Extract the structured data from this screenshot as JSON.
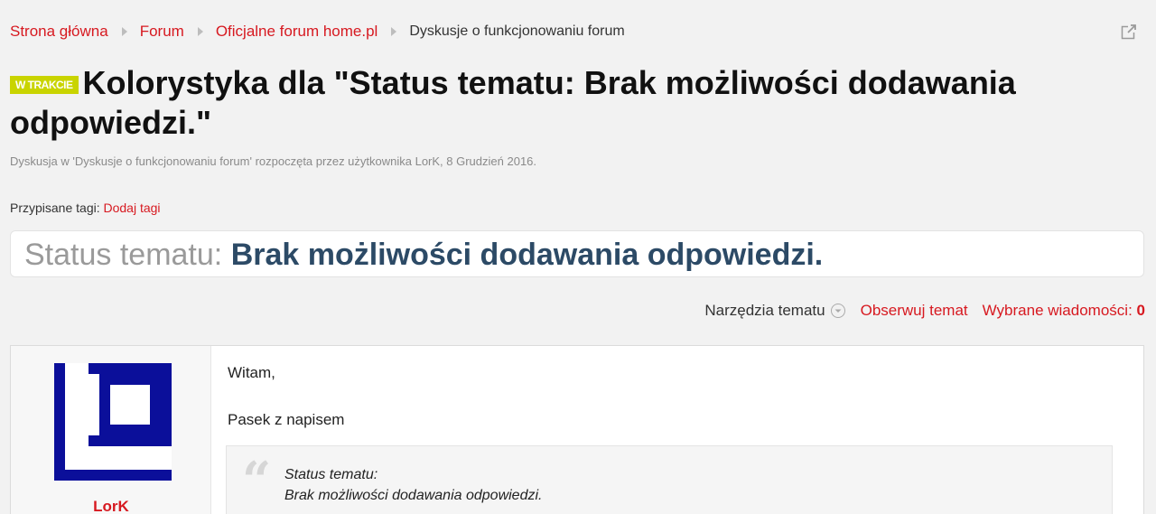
{
  "breadcrumb": {
    "items": [
      "Strona główna",
      "Forum",
      "Oficjalne forum home.pl"
    ],
    "current": "Dyskusje o funkcjonowaniu forum"
  },
  "thread": {
    "prefix": "W TRAKCIE",
    "title": "Kolorystyka dla \"Status tematu: Brak możliwości dodawania odpowiedzi.\"",
    "description": "Dyskusja w 'Dyskusje o funkcjonowaniu forum' rozpoczęta przez użytkownika LorK, 8 Grudzień 2016."
  },
  "tags": {
    "label": "Przypisane tagi:",
    "add_link": "Dodaj tagi"
  },
  "status": {
    "label": "Status tematu:",
    "value": "Brak możliwości dodawania odpowiedzi."
  },
  "tools": {
    "menu_label": "Narzędzia tematu",
    "watch_label": "Obserwuj temat",
    "selected_label": "Wybrane wiadomości:",
    "selected_count": "0"
  },
  "post": {
    "username": "LorK",
    "lines": [
      "Witam,",
      "Pasek z napisem"
    ],
    "quote": [
      "Status tematu:",
      "Brak możliwości dodawania odpowiedzi."
    ]
  },
  "colors": {
    "link": "#d71920",
    "prefix_badge": "#c9d400",
    "status_value": "#2c4a66",
    "avatar_blue": "#0b0f9a"
  },
  "icons": [
    "chevron-right-icon",
    "popout-icon",
    "circle-chevron-down-icon",
    "quote-icon"
  ]
}
